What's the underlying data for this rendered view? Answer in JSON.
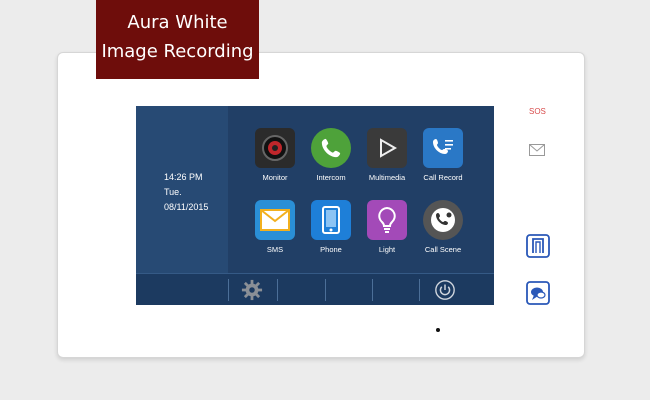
{
  "badge": {
    "line1": "Aura White",
    "line2": "Image Recording"
  },
  "clock": {
    "time": "14:26  PM",
    "day": "Tue.",
    "date": "08/11/2015"
  },
  "apps": [
    {
      "label": "Monitor",
      "icon": "camera-lens-icon",
      "color": "#2b2b2b"
    },
    {
      "label": "Intercom",
      "icon": "phone-handset-icon",
      "color": "#4ea23a"
    },
    {
      "label": "Multimedia",
      "icon": "play-icon",
      "color": "#3a3a3a"
    },
    {
      "label": "Call Record",
      "icon": "call-log-icon",
      "color": "#2a78c6"
    },
    {
      "label": "SMS",
      "icon": "envelope-icon",
      "color": "#2a8fd6"
    },
    {
      "label": "Phone",
      "icon": "smartphone-icon",
      "color": "#1e7fd8"
    },
    {
      "label": "Light",
      "icon": "lightbulb-icon",
      "color": "#a34ab8"
    },
    {
      "label": "Call Scene",
      "icon": "phone-gear-icon",
      "color": "#555555"
    }
  ],
  "taskbar": {
    "settings_icon": "gear-icon",
    "power_icon": "power-icon"
  },
  "side_panel": {
    "sos_label": "SOS",
    "message_icon": "envelope-outline-icon",
    "unlock_icon": "door-icon",
    "talk_icon": "talk-icon"
  },
  "colors": {
    "screen": "#24466e",
    "badge": "#6e0d0b",
    "sos": "#d84b4b",
    "side_icons": "#2a58b8"
  }
}
